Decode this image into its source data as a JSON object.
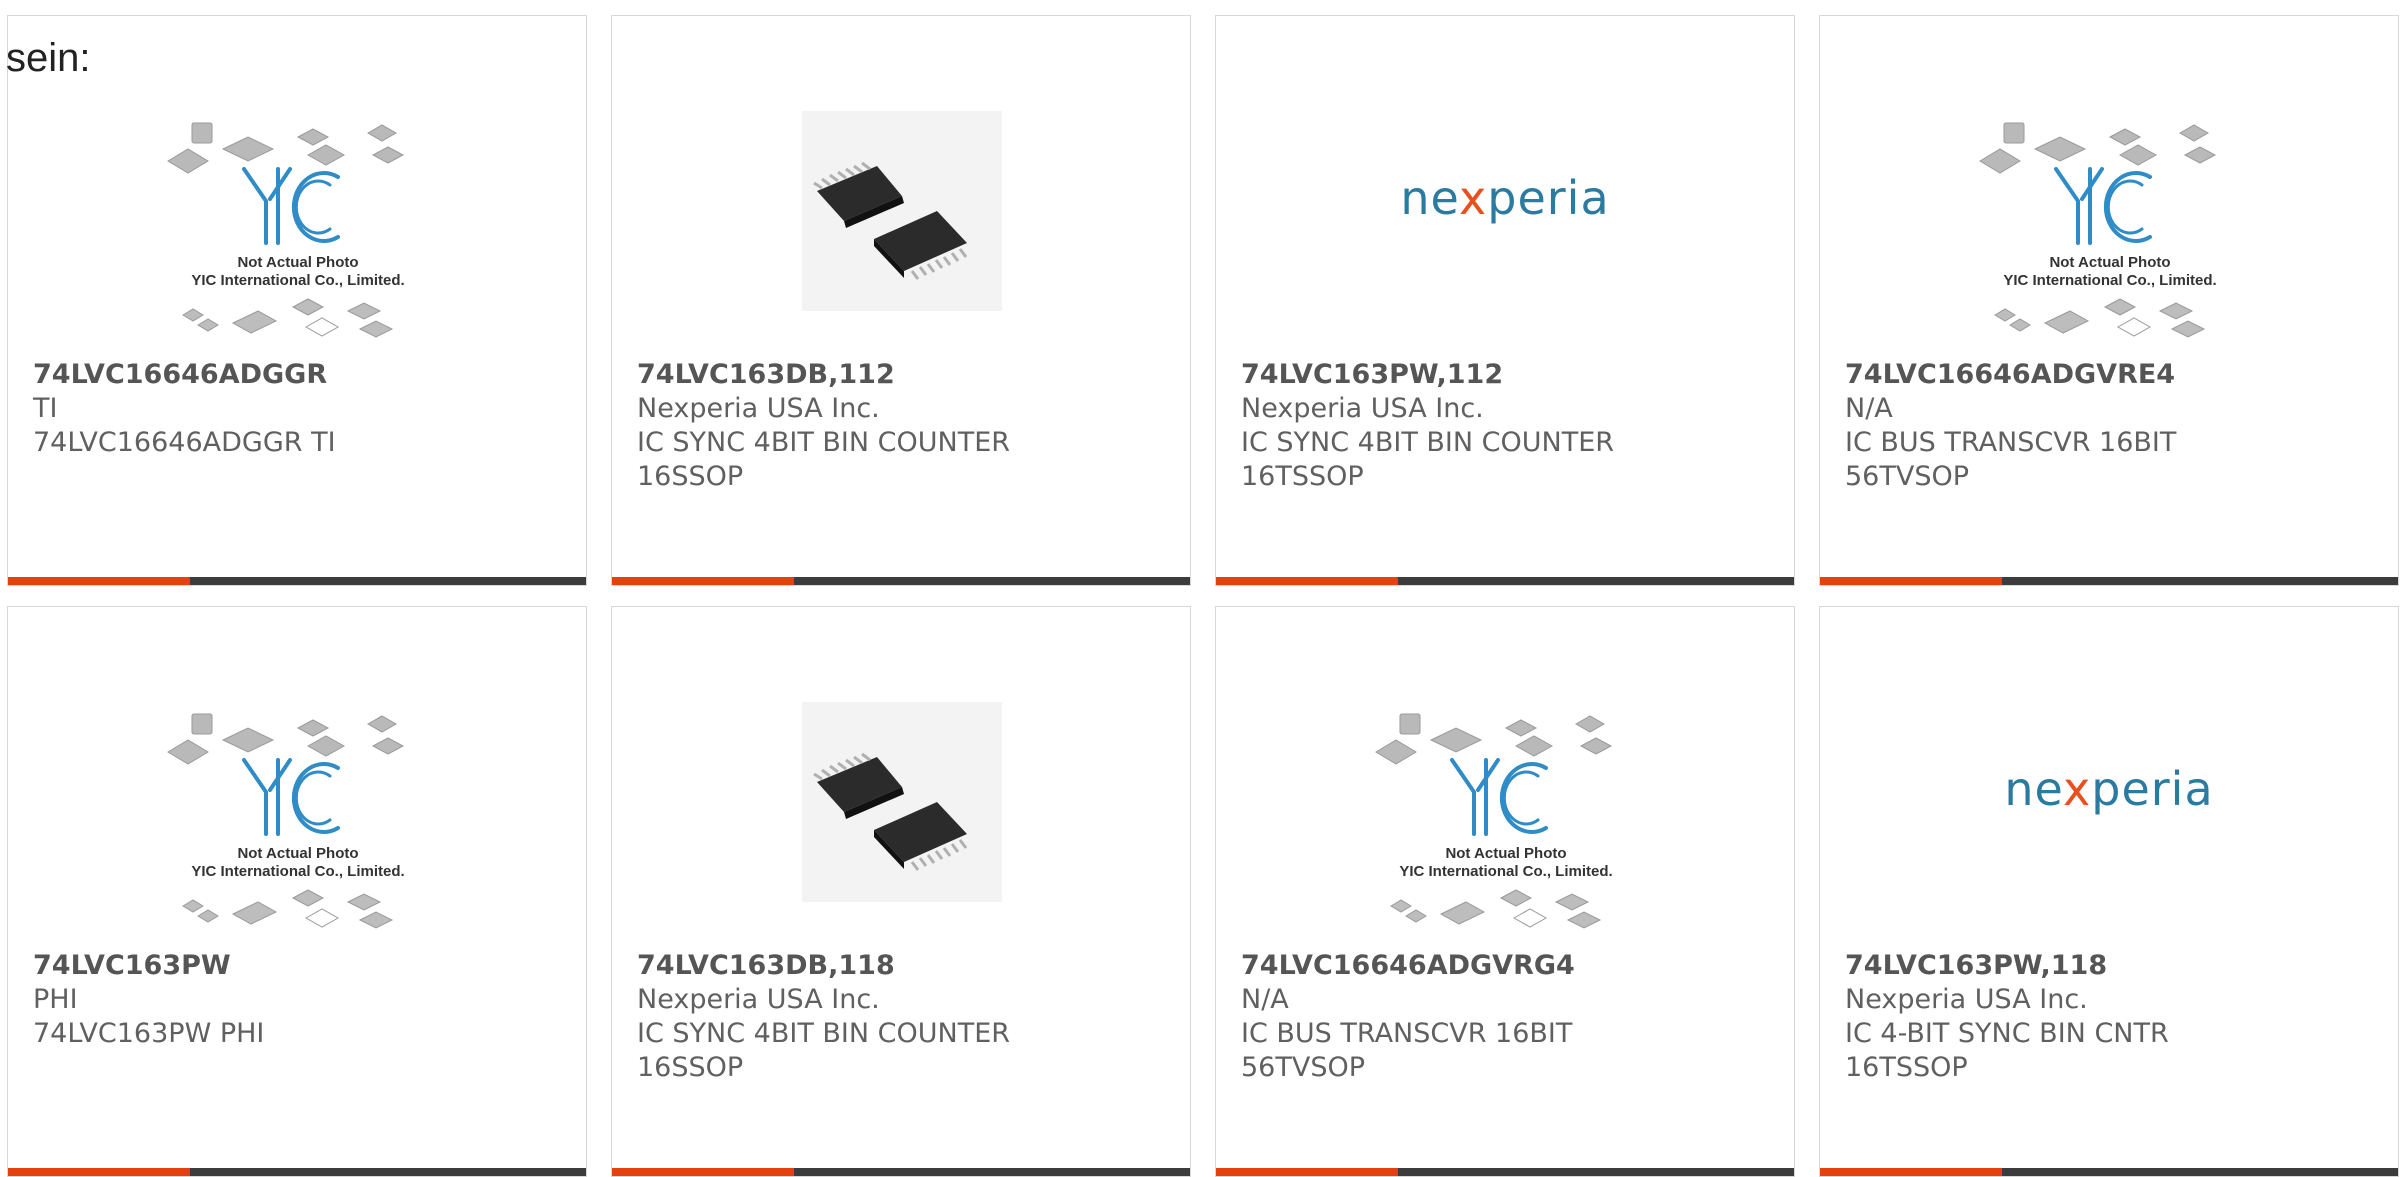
{
  "page": {
    "heading_fragment": "sein:"
  },
  "placeholder": {
    "logo": "YIC",
    "line1": "Not Actual Photo",
    "line2": "YIC International Co., Limited."
  },
  "brand_logo_text": {
    "prefix": "ne",
    "x": "x",
    "suffix": "peria"
  },
  "colors": {
    "accent": "#e5410f",
    "bar": "#3c3c3c",
    "nexperia_blue": "#2b7aa0",
    "nexperia_orange": "#e8501d"
  },
  "products": [
    {
      "part": "74LVC16646ADGGR",
      "manufacturer": "TI",
      "desc1": "74LVC16646ADGGR TI",
      "desc2": "",
      "image": "yic-placeholder"
    },
    {
      "part": "74LVC163DB,112",
      "manufacturer": "Nexperia USA Inc.",
      "desc1": "IC SYNC 4BIT BIN COUNTER",
      "desc2": "16SSOP",
      "image": "chip-photo"
    },
    {
      "part": "74LVC163PW,112",
      "manufacturer": "Nexperia USA Inc.",
      "desc1": "IC SYNC 4BIT BIN COUNTER",
      "desc2": "16TSSOP",
      "image": "nexperia-logo"
    },
    {
      "part": "74LVC16646ADGVRE4",
      "manufacturer": "N/A",
      "desc1": "IC BUS TRANSCVR 16BIT",
      "desc2": "56TVSOP",
      "image": "yic-placeholder"
    },
    {
      "part": "74LVC163PW",
      "manufacturer": "PHI",
      "desc1": "74LVC163PW PHI",
      "desc2": "",
      "image": "yic-placeholder"
    },
    {
      "part": "74LVC163DB,118",
      "manufacturer": "Nexperia USA Inc.",
      "desc1": "IC SYNC 4BIT BIN COUNTER",
      "desc2": "16SSOP",
      "image": "chip-photo"
    },
    {
      "part": "74LVC16646ADGVRG4",
      "manufacturer": "N/A",
      "desc1": "IC BUS TRANSCVR 16BIT",
      "desc2": "56TVSOP",
      "image": "yic-placeholder"
    },
    {
      "part": "74LVC163PW,118",
      "manufacturer": "Nexperia USA Inc.",
      "desc1": "IC 4-BIT SYNC BIN CNTR",
      "desc2": "16TSSOP",
      "image": "nexperia-logo"
    }
  ]
}
